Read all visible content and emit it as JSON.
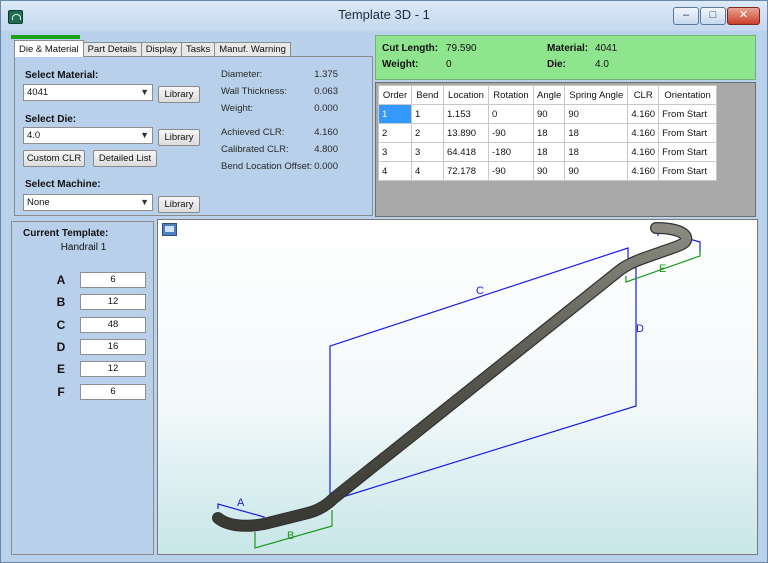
{
  "window": {
    "title": "Template 3D - 1"
  },
  "titlebar_buttons": {
    "minimize": "–",
    "maximize": "□",
    "close": "✕"
  },
  "progress": {
    "fraction": 0.19,
    "color": "#1aa31a"
  },
  "tabs": [
    {
      "label": "Die & Material",
      "active": true
    },
    {
      "label": "Part Details"
    },
    {
      "label": "Display"
    },
    {
      "label": "Tasks"
    },
    {
      "label": "Manuf. Warning"
    }
  ],
  "die_material": {
    "select_material_label": "Select Material:",
    "material_value": "4041",
    "select_die_label": "Select Die:",
    "die_value": "4.0",
    "select_machine_label": "Select Machine:",
    "machine_value": "None",
    "library_label": "Library",
    "custom_clr_label": "Custom CLR",
    "detailed_list_label": "Detailed List",
    "props": [
      {
        "label": "Diameter:",
        "value": "1.375"
      },
      {
        "label": "Wall Thickness:",
        "value": "0.063"
      },
      {
        "label": "Weight:",
        "value": "0.000"
      },
      {
        "label": "Achieved CLR:",
        "value": "4.160"
      },
      {
        "label": "Calibrated CLR:",
        "value": "4.800"
      },
      {
        "label": "Bend Location Offset:",
        "value": "0.000"
      }
    ]
  },
  "info": {
    "cut_length_label": "Cut Length:",
    "cut_length_value": "79.590",
    "weight_label": "Weight:",
    "weight_value": "0",
    "material_label": "Material:",
    "material_value": "4041",
    "die_label": "Die:",
    "die_value": "4.0",
    "color": "#8ee58e"
  },
  "bend_table": {
    "headers": [
      "Order",
      "Bend",
      "Location",
      "Rotation",
      "Angle",
      "Spring Angle",
      "CLR",
      "Orientation"
    ],
    "rows": [
      [
        "1",
        "1",
        "1.153",
        "0",
        "90",
        "90",
        "4.160",
        "From Start"
      ],
      [
        "2",
        "2",
        "13.890",
        "-90",
        "18",
        "18",
        "4.160",
        "From Start"
      ],
      [
        "3",
        "3",
        "64.418",
        "-180",
        "18",
        "18",
        "4.160",
        "From Start"
      ],
      [
        "4",
        "4",
        "72.178",
        "-90",
        "90",
        "90",
        "4.160",
        "From Start"
      ]
    ],
    "selected_color": "#3399ff"
  },
  "template": {
    "current_label": "Current Template:",
    "name": "Handrail 1",
    "dims": [
      {
        "label": "A",
        "value": "6"
      },
      {
        "label": "B",
        "value": "12"
      },
      {
        "label": "C",
        "value": "48"
      },
      {
        "label": "D",
        "value": "16"
      },
      {
        "label": "E",
        "value": "12"
      },
      {
        "label": "F",
        "value": "6"
      }
    ]
  },
  "viewport": {
    "icon": "monitor-icon",
    "dimension_labels": {
      "A": "A",
      "B": "B",
      "C": "C",
      "D": "D",
      "E": "E"
    },
    "colors": {
      "dimension_blue": "#1a1ae6",
      "dimension_green": "#1c9a1c",
      "tube": "#5a5a52"
    }
  }
}
